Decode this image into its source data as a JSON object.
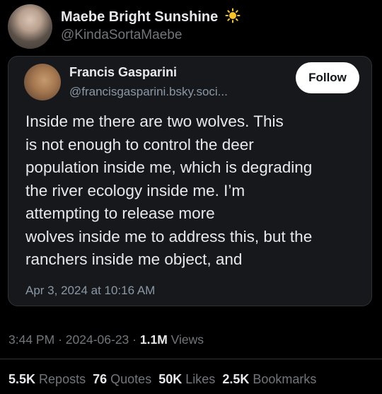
{
  "tweet": {
    "author_name": "Maebe Bright Sunshine",
    "author_handle": "@KindaSortaMaebe",
    "time": "3:44 PM",
    "date": "2024-06-23",
    "views_count": "1.1M",
    "views_label": "Views"
  },
  "quote": {
    "author_name": "Francis Gasparini",
    "author_handle": "@francisgasparini.bsky.soci...",
    "follow_label": "Follow",
    "body_lines": [
      "Inside me there are two wolves. This",
      "is not enough to control the deer",
      "population inside me, which is degrading",
      "the river ecology inside me. I’m",
      "attempting to release more",
      "wolves inside me to address this, but the",
      "ranchers inside me object, and"
    ],
    "date": "Apr 3, 2024 at 10:16 AM"
  },
  "stats": {
    "reposts_count": "5.5K",
    "reposts_label": "Reposts",
    "quotes_count": "76",
    "quotes_label": "Quotes",
    "likes_count": "50K",
    "likes_label": "Likes",
    "bookmarks_count": "2.5K",
    "bookmarks_label": "Bookmarks"
  },
  "icons": {
    "emoji": "sun-icon"
  },
  "colors": {
    "background": "#000000",
    "card": "#16181c",
    "secondary_text": "#71767b",
    "sun": "#f7c325"
  }
}
